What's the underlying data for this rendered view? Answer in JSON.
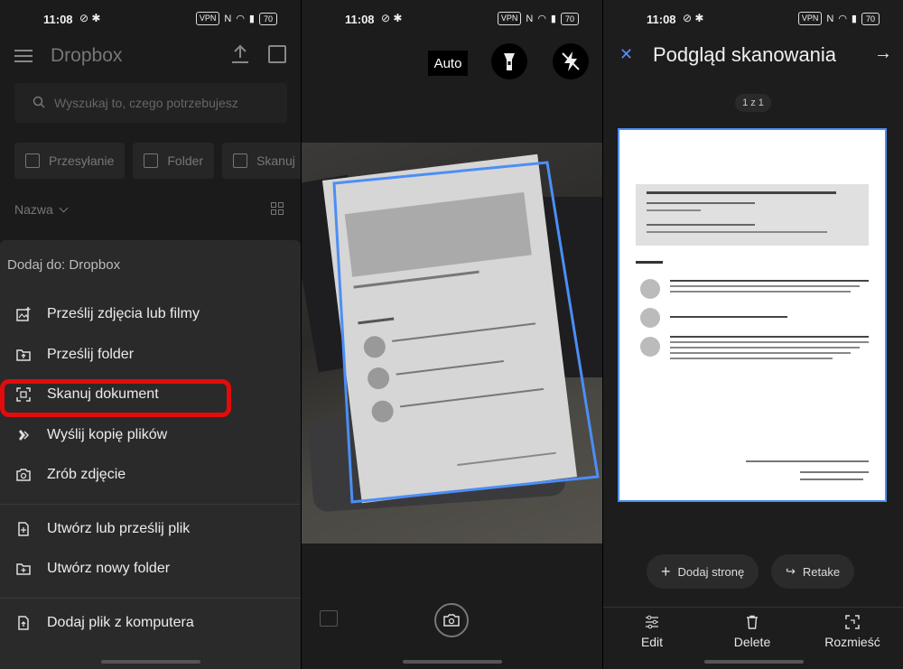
{
  "status_bar": {
    "time": "11:08",
    "vpn": "VPN",
    "battery": "70"
  },
  "panel1": {
    "app_title": "Dropbox",
    "search_placeholder": "Wyszukaj to, czego potrzebujesz",
    "chips": [
      "Przesyłanie",
      "Folder",
      "Skanuj"
    ],
    "sort_label": "Nazwa",
    "sheet_title": "Dodaj do: Dropbox",
    "menu": [
      {
        "label": "Prześlij zdjęcia lub filmy",
        "icon": "photo-upload-icon"
      },
      {
        "label": "Prześlij folder",
        "icon": "folder-upload-icon"
      },
      {
        "label": "Skanuj dokument",
        "icon": "scan-icon"
      },
      {
        "label": "Wyślij kopię plików",
        "icon": "transfer-icon"
      },
      {
        "label": "Zrób zdjęcie",
        "icon": "camera-icon"
      },
      {
        "label": "Utwórz lub prześlij plik",
        "icon": "new-file-icon"
      },
      {
        "label": "Utwórz nowy folder",
        "icon": "new-folder-icon"
      },
      {
        "label": "Dodaj plik z komputera",
        "icon": "computer-file-icon"
      }
    ]
  },
  "panel2": {
    "auto_label": "Auto"
  },
  "panel3": {
    "title": "Podgląd skanowania",
    "page_count": "1 z 1",
    "add_page": "Dodaj stronę",
    "retake": "Retake",
    "actions": [
      "Edit",
      "Delete",
      "Rozmieść"
    ]
  },
  "colors": {
    "accent": "#4c8ef5",
    "highlight": "#e30b0b"
  }
}
